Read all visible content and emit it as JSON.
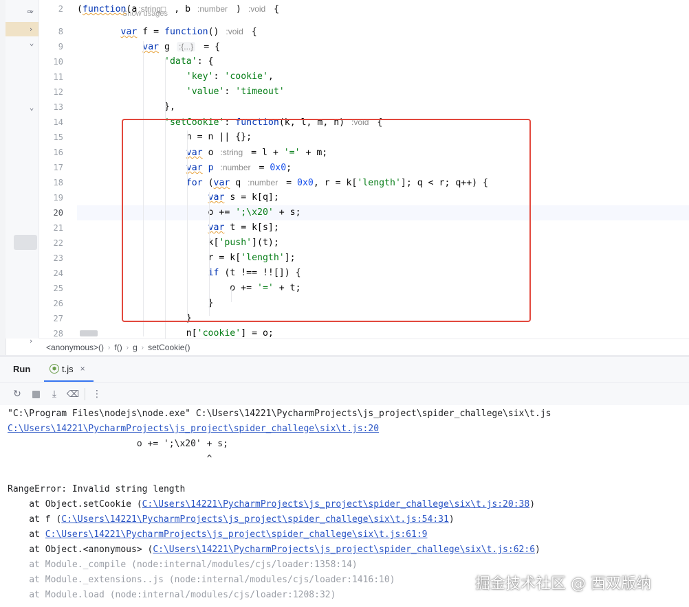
{
  "editor": {
    "usages_hint": "Show usages",
    "lines": [
      {
        "n": "2",
        "tokens": [
          {
            "t": "(",
            "c": ""
          },
          {
            "t": "function",
            "c": "kw",
            "sq": true
          },
          {
            "t": "(a",
            "c": ""
          },
          {
            "t": ":string□",
            "c": "hint-plain"
          },
          {
            "t": " , b ",
            "c": ""
          },
          {
            "t": ":number",
            "c": "hint-plain"
          },
          {
            "t": " ) ",
            "c": ""
          },
          {
            "t": ":void",
            "c": "hint-plain"
          },
          {
            "t": " {",
            "c": ""
          }
        ]
      },
      {
        "n": "8",
        "tokens": [
          {
            "t": "        ",
            "c": ""
          },
          {
            "t": "var",
            "c": "kw",
            "sq": true
          },
          {
            "t": " f = ",
            "c": ""
          },
          {
            "t": "function",
            "c": "kw"
          },
          {
            "t": "() ",
            "c": ""
          },
          {
            "t": ":void",
            "c": "hint-plain"
          },
          {
            "t": " {",
            "c": ""
          }
        ]
      },
      {
        "n": "9",
        "tokens": [
          {
            "t": "            ",
            "c": ""
          },
          {
            "t": "var",
            "c": "kw",
            "sq": true
          },
          {
            "t": " g ",
            "c": ""
          },
          {
            "t": ":{...}",
            "c": "hint"
          },
          {
            "t": " = {",
            "c": ""
          }
        ]
      },
      {
        "n": "10",
        "tokens": [
          {
            "t": "                ",
            "c": ""
          },
          {
            "t": "'data'",
            "c": "str"
          },
          {
            "t": ": {",
            "c": ""
          }
        ]
      },
      {
        "n": "11",
        "tokens": [
          {
            "t": "                    ",
            "c": ""
          },
          {
            "t": "'key'",
            "c": "str"
          },
          {
            "t": ": ",
            "c": ""
          },
          {
            "t": "'cookie'",
            "c": "str"
          },
          {
            "t": ",",
            "c": ""
          }
        ]
      },
      {
        "n": "12",
        "tokens": [
          {
            "t": "                    ",
            "c": ""
          },
          {
            "t": "'value'",
            "c": "str"
          },
          {
            "t": ": ",
            "c": ""
          },
          {
            "t": "'timeout'",
            "c": "str"
          }
        ]
      },
      {
        "n": "13",
        "tokens": [
          {
            "t": "                },",
            "c": ""
          }
        ]
      },
      {
        "n": "14",
        "tokens": [
          {
            "t": "                ",
            "c": ""
          },
          {
            "t": "'setCookie'",
            "c": "str"
          },
          {
            "t": ": ",
            "c": ""
          },
          {
            "t": "function",
            "c": "kw"
          },
          {
            "t": "(k, l, m, n) ",
            "c": ""
          },
          {
            "t": ":void",
            "c": "hint-plain"
          },
          {
            "t": " {",
            "c": ""
          }
        ]
      },
      {
        "n": "15",
        "tokens": [
          {
            "t": "                    n = n || {};",
            "c": ""
          }
        ]
      },
      {
        "n": "16",
        "tokens": [
          {
            "t": "                    ",
            "c": ""
          },
          {
            "t": "var",
            "c": "kw",
            "sq": true
          },
          {
            "t": " o ",
            "c": ""
          },
          {
            "t": ":string",
            "c": "hint-plain"
          },
          {
            "t": " = l + ",
            "c": ""
          },
          {
            "t": "'='",
            "c": "str"
          },
          {
            "t": " + m;",
            "c": ""
          }
        ]
      },
      {
        "n": "17",
        "tokens": [
          {
            "t": "                    ",
            "c": ""
          },
          {
            "t": "var",
            "c": "kw",
            "sq": true
          },
          {
            "t": " ",
            "c": ""
          },
          {
            "t": "p",
            "c": "kw"
          },
          {
            "t": " ",
            "c": ""
          },
          {
            "t": ":number",
            "c": "hint-plain"
          },
          {
            "t": " = ",
            "c": ""
          },
          {
            "t": "0x0",
            "c": "num"
          },
          {
            "t": ";",
            "c": ""
          }
        ]
      },
      {
        "n": "18",
        "tokens": [
          {
            "t": "                    ",
            "c": ""
          },
          {
            "t": "for",
            "c": "kw"
          },
          {
            "t": " (",
            "c": ""
          },
          {
            "t": "var",
            "c": "kw",
            "sq": true
          },
          {
            "t": " q ",
            "c": ""
          },
          {
            "t": ":number",
            "c": "hint-plain"
          },
          {
            "t": " = ",
            "c": ""
          },
          {
            "t": "0x0",
            "c": "num"
          },
          {
            "t": ", r = k[",
            "c": ""
          },
          {
            "t": "'length'",
            "c": "str"
          },
          {
            "t": "]; q < r; q++) {",
            "c": ""
          }
        ]
      },
      {
        "n": "19",
        "tokens": [
          {
            "t": "                        ",
            "c": ""
          },
          {
            "t": "var",
            "c": "kw",
            "sq": true
          },
          {
            "t": " s = k[q];",
            "c": ""
          }
        ]
      },
      {
        "n": "20",
        "tokens": [
          {
            "t": "                        o += ",
            "c": ""
          },
          {
            "t": "';\\x20'",
            "c": "str"
          },
          {
            "t": " + s;",
            "c": ""
          }
        ]
      },
      {
        "n": "21",
        "tokens": [
          {
            "t": "                        ",
            "c": ""
          },
          {
            "t": "var",
            "c": "kw",
            "sq": true
          },
          {
            "t": " t = k[s];",
            "c": ""
          }
        ]
      },
      {
        "n": "22",
        "tokens": [
          {
            "t": "                        k[",
            "c": ""
          },
          {
            "t": "'push'",
            "c": "str"
          },
          {
            "t": "](t);",
            "c": ""
          }
        ]
      },
      {
        "n": "23",
        "tokens": [
          {
            "t": "                        r = k[",
            "c": ""
          },
          {
            "t": "'length'",
            "c": "str"
          },
          {
            "t": "];",
            "c": ""
          }
        ]
      },
      {
        "n": "24",
        "tokens": [
          {
            "t": "                        ",
            "c": ""
          },
          {
            "t": "if",
            "c": "kw"
          },
          {
            "t": " (t !== !![]) {",
            "c": ""
          }
        ]
      },
      {
        "n": "25",
        "tokens": [
          {
            "t": "                            o += ",
            "c": ""
          },
          {
            "t": "'='",
            "c": "str"
          },
          {
            "t": " + t;",
            "c": ""
          }
        ]
      },
      {
        "n": "26",
        "tokens": [
          {
            "t": "                        }",
            "c": ""
          }
        ]
      },
      {
        "n": "27",
        "tokens": [
          {
            "t": "                    }",
            "c": ""
          }
        ]
      },
      {
        "n": "28",
        "tokens": [
          {
            "t": "                    n[",
            "c": ""
          },
          {
            "t": "'cookie'",
            "c": "str"
          },
          {
            "t": "] = o;",
            "c": ""
          }
        ]
      }
    ]
  },
  "breadcrumb": [
    "<anonymous>()",
    "f()",
    "g",
    "setCookie()"
  ],
  "run": {
    "title": "Run",
    "tab_label": "t.js",
    "tab_close": "×",
    "toolbar": [
      {
        "name": "rerun-icon",
        "glyph": "↻"
      },
      {
        "name": "stop-icon",
        "glyph": ""
      },
      {
        "name": "scroll-to-end-icon",
        "glyph": "⤓"
      },
      {
        "name": "trash-icon",
        "glyph": "🗑"
      },
      {
        "name": "more-options-icon",
        "glyph": "⋮"
      }
    ]
  },
  "console": [
    {
      "segs": [
        {
          "t": "\"C:\\Program Files\\nodejs\\node.exe\" C:\\Users\\14221\\PycharmProjects\\js_project\\spider_challege\\six\\t.js",
          "c": ""
        }
      ]
    },
    {
      "segs": [
        {
          "t": "C:\\Users\\14221\\PycharmProjects\\js_project\\spider_challege\\six\\t.js:20",
          "c": "link"
        }
      ]
    },
    {
      "segs": [
        {
          "t": "                        o += ';\\x20' + s;",
          "c": ""
        }
      ]
    },
    {
      "segs": [
        {
          "t": "                                     ^",
          "c": ""
        }
      ]
    },
    {
      "segs": [
        {
          "t": "",
          "c": ""
        }
      ]
    },
    {
      "segs": [
        {
          "t": "RangeError: Invalid string length",
          "c": ""
        }
      ]
    },
    {
      "segs": [
        {
          "t": "    at Object.setCookie (",
          "c": ""
        },
        {
          "t": "C:\\Users\\14221\\PycharmProjects\\js_project\\spider_challege\\six\\t.js:20:38",
          "c": "link"
        },
        {
          "t": ")",
          "c": ""
        }
      ]
    },
    {
      "segs": [
        {
          "t": "    at f (",
          "c": ""
        },
        {
          "t": "C:\\Users\\14221\\PycharmProjects\\js_project\\spider_challege\\six\\t.js:54:31",
          "c": "link"
        },
        {
          "t": ")",
          "c": ""
        }
      ]
    },
    {
      "segs": [
        {
          "t": "    at ",
          "c": ""
        },
        {
          "t": "C:\\Users\\14221\\PycharmProjects\\js_project\\spider_challege\\six\\t.js:61:9",
          "c": "link"
        }
      ]
    },
    {
      "segs": [
        {
          "t": "    at Object.<anonymous> (",
          "c": ""
        },
        {
          "t": "C:\\Users\\14221\\PycharmProjects\\js_project\\spider_challege\\six\\t.js:62:6",
          "c": "link"
        },
        {
          "t": ")",
          "c": ""
        }
      ]
    },
    {
      "dim": true,
      "segs": [
        {
          "t": "    at Module._compile (node:internal/modules/cjs/loader:1358:14)",
          "c": ""
        }
      ]
    },
    {
      "dim": true,
      "segs": [
        {
          "t": "    at Module._extensions..js (node:internal/modules/cjs/loader:1416:10)",
          "c": ""
        }
      ]
    },
    {
      "dim": true,
      "segs": [
        {
          "t": "    at Module.load (node:internal/modules/cjs/loader:1208:32)",
          "c": ""
        }
      ]
    }
  ],
  "watermark": "掘金技术社区 @ 西双版纳",
  "colors": {
    "annotation": "#e2483d",
    "link": "#2a55c5",
    "keyword": "#0033b3",
    "string": "#067d17",
    "number": "#1750eb"
  }
}
